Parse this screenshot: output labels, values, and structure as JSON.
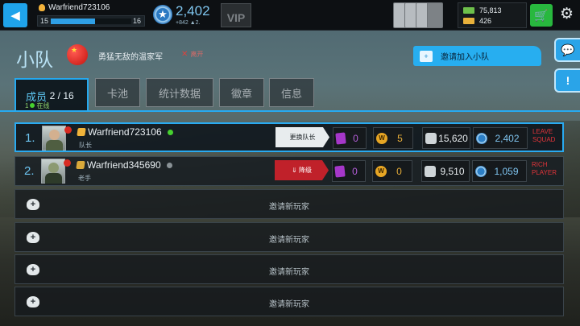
{
  "colors": {
    "accent": "#27aaf0",
    "danger": "#c0212a",
    "online": "#46d12f",
    "offline": "#8a9296",
    "currency_cash": "#6ec04b"
  },
  "topbar": {
    "back_icon": "back-arrow-icon",
    "player_name": "Warfriend723106",
    "level_current": "15",
    "level_next": "16",
    "level_progress": 0.55,
    "rating": "2,402",
    "rating_delta": "+842",
    "rating_extra": "▲2.",
    "vip_label": "VIP",
    "cash": "75,813",
    "gold": "426",
    "settings_icon": "gear-icon"
  },
  "squad": {
    "title": "小队",
    "name": "勇猛无敌的温家军",
    "leave_label": "离开",
    "invite_button": "邀请加入小队"
  },
  "tabs": [
    {
      "label": "成员",
      "count": "2 / 16",
      "online": "1",
      "online_label": "在线"
    },
    {
      "label": "卡池"
    },
    {
      "label": "统计数据"
    },
    {
      "label": "徽章"
    },
    {
      "label": "信息"
    }
  ],
  "members": [
    {
      "rank": "1.",
      "name": "Warfriend723106",
      "role": "队长",
      "action": "更换队长",
      "cards": "0",
      "wins": "5",
      "power": "15,620",
      "rating": "2,402",
      "note": "LEAVE SQUAD",
      "online": true
    },
    {
      "rank": "2.",
      "name": "Warfriend345690",
      "role": "老手",
      "action": "降级",
      "cards": "0",
      "wins": "0",
      "power": "9,510",
      "rating": "1,059",
      "note": "RICH PLAYER",
      "online": false
    }
  ],
  "invite_slots": [
    {
      "label": "邀请新玩家"
    },
    {
      "label": "邀请新玩家"
    },
    {
      "label": "邀请新玩家"
    },
    {
      "label": "邀请新玩家"
    }
  ]
}
